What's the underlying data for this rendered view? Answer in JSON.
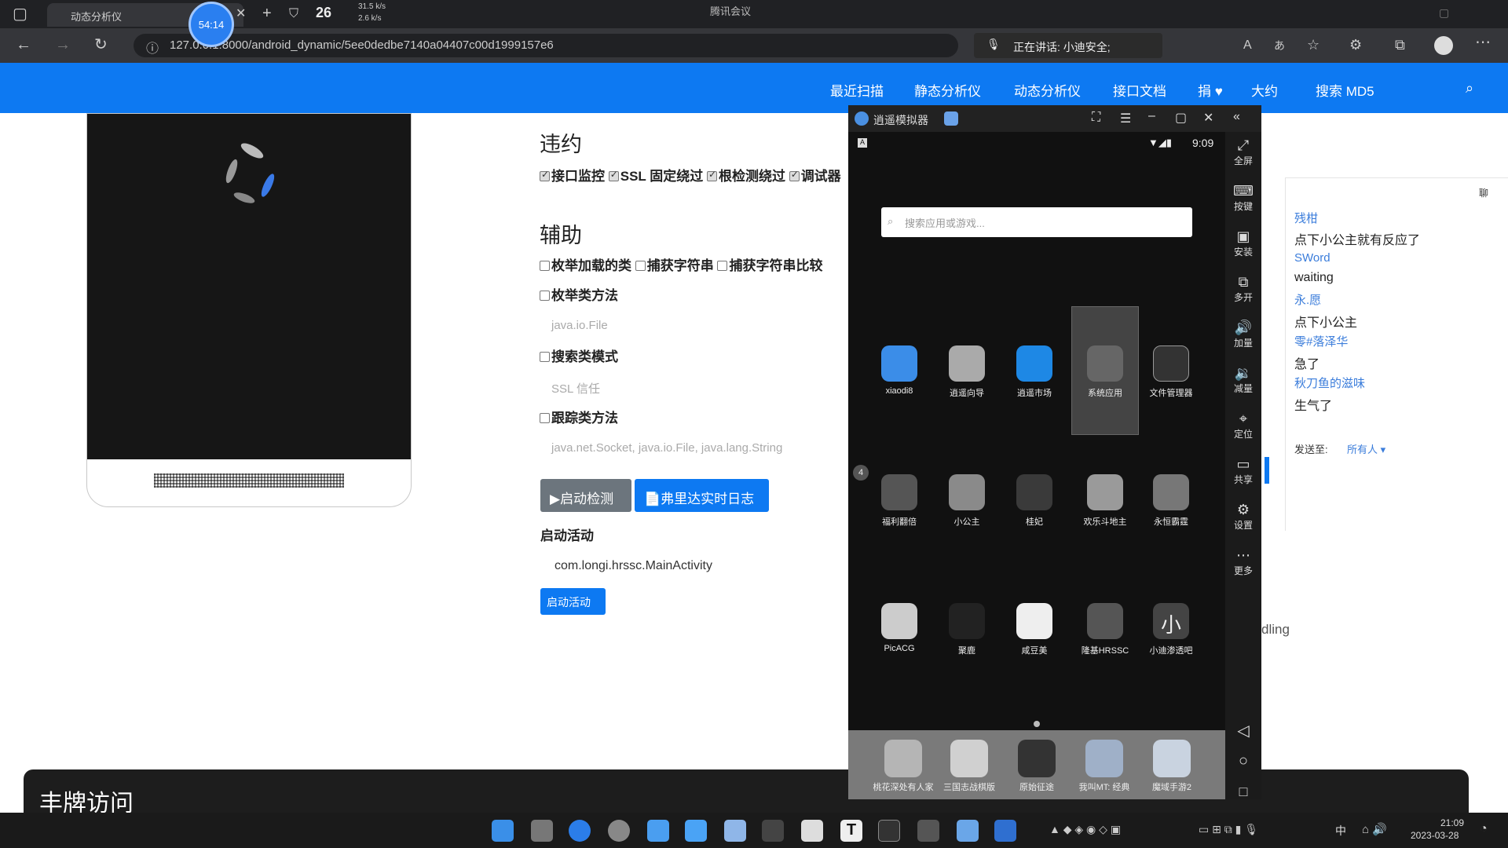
{
  "browser": {
    "tab_title": "动态分析仪",
    "tab_badge": "54:14",
    "temperature": "26",
    "net_up": "31.5 k/s",
    "net_down": "2.6 k/s",
    "window_title": "腾讯会议",
    "url": "127.0.0.1:8000/android_dynamic/5ee0dedbe7140a04407c00d1999157e6",
    "speaking": "正在讲话: 小迪安全;"
  },
  "nav": {
    "items": [
      "最近扫描",
      "静态分析仪",
      "动态分析仪",
      "接口文档",
      "捐 ♥",
      "大约",
      "搜索 MD5"
    ]
  },
  "main": {
    "section_violation": "违约",
    "violation_checks": [
      {
        "label": "接口监控",
        "checked": true
      },
      {
        "label": "SSL 固定绕过",
        "checked": true
      },
      {
        "label": "根检测绕过",
        "checked": true
      },
      {
        "label": "调试器",
        "checked": true
      }
    ],
    "section_aux": "辅助",
    "aux_checks": [
      {
        "label": "枚举加载的类",
        "checked": false
      },
      {
        "label": "捕获字符串",
        "checked": false
      },
      {
        "label": "捕获字符串比较",
        "checked": false
      }
    ],
    "enum_methods": "枚举类方法",
    "enum_methods_hint": "java.io.File",
    "search_pattern": "搜索类模式",
    "search_pattern_hint": "SSL 信任",
    "trace_methods": "跟踪类方法",
    "trace_methods_hint": "java.net.Socket, java.io.File, java.lang.String",
    "start_btn": "▶启动检测",
    "log_btn": "📄弗里达实时日志",
    "start_activity_title": "启动活动",
    "activity_name": "com.longi.hrssc.MainActivity",
    "start_activity_btn": "启动活动",
    "bottom_banner": "丰牌访问",
    "partial_text": "dling"
  },
  "emulator": {
    "title": "逍遥模拟器",
    "time": "9:09",
    "search_placeholder": "搜索应用或游戏...",
    "side": [
      "全屏",
      "按键",
      "安装",
      "多开",
      "加量",
      "减量",
      "定位",
      "共享",
      "设置",
      "更多"
    ],
    "apps_row1": [
      "xiaodi8",
      "逍遥向导",
      "逍遥市场",
      "系统应用",
      "文件管理器"
    ],
    "apps_row2": [
      "福利翻倍",
      "小公主",
      "桂妃",
      "欢乐斗地主",
      "永恒霸霆"
    ],
    "apps_row3": [
      "PicACG",
      "聚鹿",
      "咸豆美",
      "隆基HRSSC",
      "小迪渗透吧"
    ],
    "dock": [
      "桃花深处有人家",
      "三国志战棋版",
      "原始征途",
      "我叫MT: 经典",
      "魔域手游2"
    ],
    "badge": "4"
  },
  "chat": {
    "messages": [
      {
        "nick": "残柑",
        "text": "点下小公主就有反应了"
      },
      {
        "nick": "SWord",
        "text": "waiting"
      },
      {
        "nick": "永.愿",
        "text": "点下小公主"
      },
      {
        "nick": "零#落泽华",
        "text": "急了"
      },
      {
        "nick": "秋刀鱼的滋味",
        "text": "生气了"
      }
    ],
    "send_to_label": "发送至:",
    "send_to_value": "所有人 ▾",
    "header": "聊"
  },
  "taskbar": {
    "time": "21:09",
    "date": "2023-03-28",
    "ime": "中"
  },
  "colors": {
    "nav_blue": "#0d79f2",
    "btn_gray": "#6c757d",
    "btn_blue": "#0d79f2"
  }
}
